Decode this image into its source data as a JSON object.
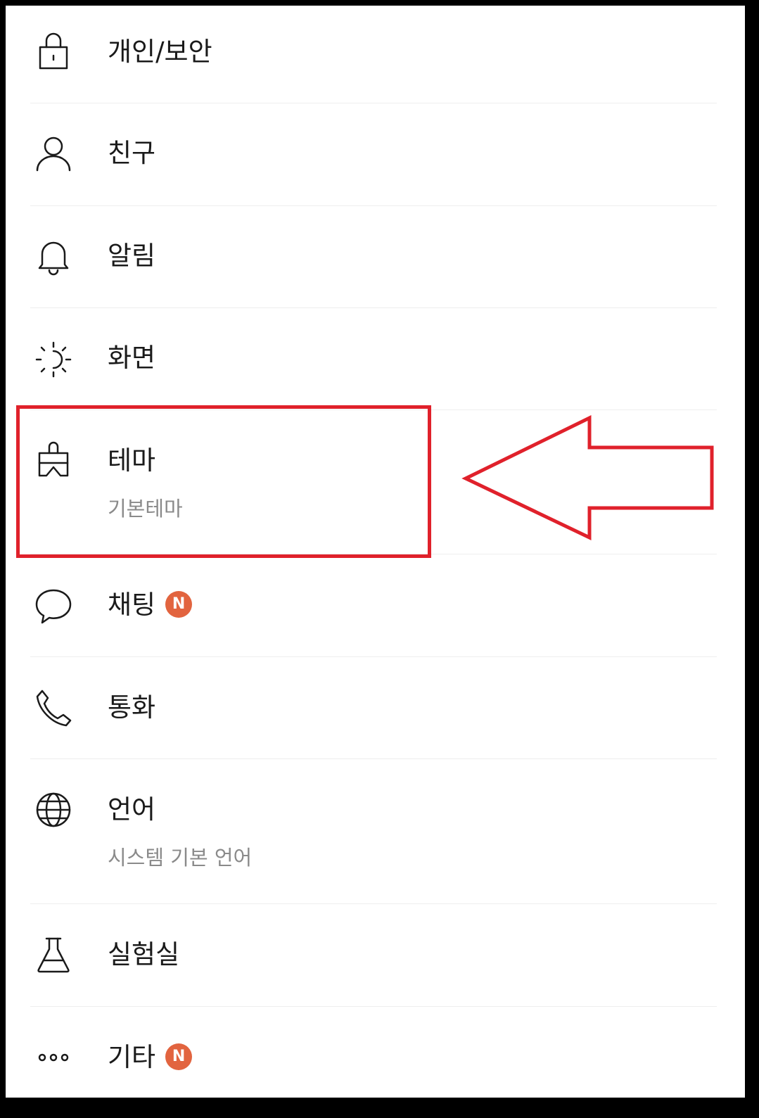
{
  "colors": {
    "accent_red": "#e0212b",
    "badge": "#e2643f",
    "icon_stroke": "#1a1a1a",
    "sublabel": "#8a8a8a"
  },
  "settings": {
    "items": [
      {
        "label": "개인/보안",
        "icon": "lock-icon"
      },
      {
        "label": "친구",
        "icon": "person-icon"
      },
      {
        "label": "알림",
        "icon": "bell-icon"
      },
      {
        "label": "화면",
        "icon": "brightness-icon"
      },
      {
        "label": "테마",
        "sublabel": "기본테마",
        "icon": "brush-icon"
      },
      {
        "label": "채팅",
        "icon": "chat-bubble-icon",
        "badge": "N"
      },
      {
        "label": "통화",
        "icon": "phone-icon"
      },
      {
        "label": "언어",
        "sublabel": "시스템 기본 언어",
        "icon": "globe-icon"
      },
      {
        "label": "실험실",
        "icon": "flask-icon"
      },
      {
        "label": "기타",
        "icon": "more-dots-icon",
        "badge": "N"
      }
    ]
  },
  "annotation": {
    "highlight_target": "테마",
    "arrow_direction": "left"
  }
}
